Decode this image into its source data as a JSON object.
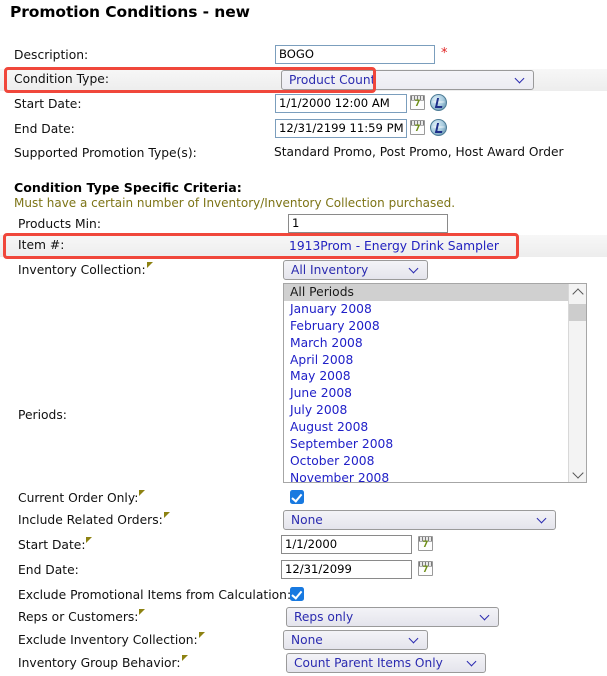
{
  "page": {
    "title_main": "Promotion Conditions",
    "title_sep": " - ",
    "title_suffix": "new"
  },
  "form": {
    "description": {
      "label": "Description:",
      "value": "BOGO",
      "required_marker": "*"
    },
    "condition_type": {
      "label": "Condition Type:",
      "value": "Product Count"
    },
    "start_date": {
      "label": "Start Date:",
      "value": "1/1/2000 12:00 AM",
      "calendar_icon_day": "7"
    },
    "end_date": {
      "label": "End Date:",
      "value": "12/31/2199 11:59 PM",
      "calendar_icon_day": "7"
    },
    "supported_promotion_types": {
      "label": "Supported Promotion Type(s):",
      "value": "Standard Promo, Post Promo, Host Award Order"
    }
  },
  "criteria": {
    "heading": "Condition Type Specific Criteria:",
    "description": "Must have a certain number of Inventory/Inventory Collection purchased.",
    "products_min": {
      "label": "Products Min:",
      "value": "1"
    },
    "item_number": {
      "label": "Item #:",
      "value": "1913Prom - Energy Drink Sampler"
    },
    "inventory_collection": {
      "label": "Inventory Collection:",
      "value": "All Inventory"
    },
    "periods": {
      "label": "Periods:",
      "options": [
        "All Periods",
        "January 2008",
        "February 2008",
        "March 2008",
        "April 2008",
        "May 2008",
        "June 2008",
        "July 2008",
        "August 2008",
        "September 2008",
        "October 2008",
        "November 2008"
      ],
      "selected": "All Periods"
    },
    "current_order_only": {
      "label": "Current Order Only:",
      "checked": true
    },
    "include_related_orders": {
      "label": "Include Related Orders:",
      "value": "None"
    },
    "start_date": {
      "label": "Start Date:",
      "value": "1/1/2000",
      "calendar_icon_day": "7"
    },
    "end_date": {
      "label": "End Date:",
      "value": "12/31/2099",
      "calendar_icon_day": "7"
    },
    "exclude_promotional_items": {
      "label": "Exclude Promotional Items from Calculation:",
      "checked": true
    },
    "reps_or_customers": {
      "label": "Reps or Customers:",
      "value": "Reps only"
    },
    "exclude_inventory_collection": {
      "label": "Exclude Inventory Collection:",
      "value": "None"
    },
    "inventory_group_behavior": {
      "label": "Inventory Group Behavior:",
      "value": "Count Parent Items Only"
    }
  },
  "highlights": {
    "condition_type_box": "red-highlight",
    "item_number_box": "red-highlight",
    "color": "#f0473b"
  }
}
